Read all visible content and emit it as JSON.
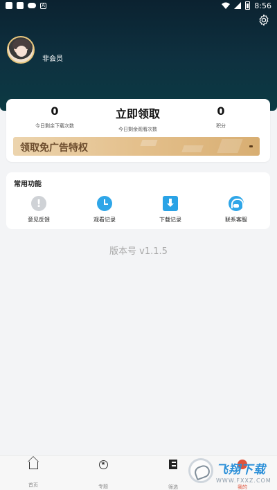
{
  "status_bar": {
    "time": "8:56",
    "left_icons": [
      "notification-icon",
      "square-icon",
      "cloud-icon",
      "a-icon"
    ],
    "right_icons": [
      "wifi-icon",
      "signal-icon",
      "battery-icon"
    ]
  },
  "header": {
    "settings_icon": "gear-icon",
    "nickname": "非会员"
  },
  "stats": [
    {
      "value": "0",
      "label": "今日剩余下载次数"
    },
    {
      "value": "立即领取",
      "label": "今日剩余观看次数"
    },
    {
      "value": "0",
      "label": "积分"
    }
  ],
  "banner": {
    "text": "领取免广告特权"
  },
  "functions": {
    "title": "常用功能",
    "items": [
      {
        "label": "意见反馈",
        "icon": "feedback-icon"
      },
      {
        "label": "观看记录",
        "icon": "clock-icon"
      },
      {
        "label": "下载记录",
        "icon": "download-icon"
      },
      {
        "label": "联系客服",
        "icon": "headset-icon"
      }
    ]
  },
  "version": "版本号 v1.1.5",
  "tabbar": {
    "tabs": [
      {
        "label": "首页",
        "icon": "home-icon",
        "active": false
      },
      {
        "label": "专题",
        "icon": "topic-icon",
        "active": false
      },
      {
        "label": "筛选",
        "icon": "filter-icon",
        "active": false
      },
      {
        "label": "我的",
        "icon": "mine-icon",
        "active": true
      }
    ],
    "active_color": "#e0533b"
  },
  "watermark": {
    "text": "飞翔下载",
    "url": "WWW.FXXZ.COM"
  },
  "colors": {
    "header_bg": "#0e3140",
    "accent_blue": "#2fa6e8",
    "banner_gold": "#e4c08c"
  }
}
